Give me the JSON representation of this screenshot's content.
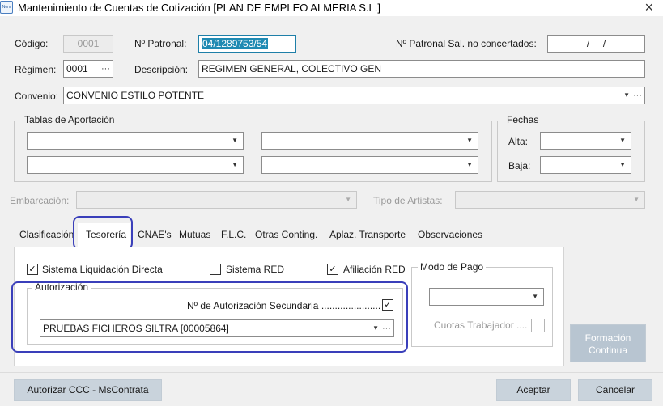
{
  "window": {
    "title": "Mantenimiento de Cuentas de Cotización [PLAN DE EMPLEO ALMERIA S.L.]",
    "app_icon_text": "Nom"
  },
  "header": {
    "codigo_label": "Código:",
    "codigo_value": "0001",
    "patronal_label": "Nº Patronal:",
    "patronal_value": "04/1289753/54",
    "patronal_sal_label": "Nº Patronal Sal. no concertados:",
    "patronal_sal_value": "/     /",
    "regimen_label": "Régimen:",
    "regimen_value": "0001",
    "descripcion_label": "Descripción:",
    "descripcion_value": "REGIMEN GENERAL, COLECTIVO GEN",
    "convenio_label": "Convenio:",
    "convenio_value": "CONVENIO ESTILO POTENTE"
  },
  "tablas": {
    "title": "Tablas de Aportación"
  },
  "fechas": {
    "title": "Fechas",
    "alta_label": "Alta:",
    "baja_label": "Baja:"
  },
  "embarcacion": {
    "label": "Embarcación:",
    "tipo_artistas_label": "Tipo de Artistas:"
  },
  "tabs": [
    "Clasificación",
    "Tesorería",
    "CNAE's",
    "Mutuas",
    "F.L.C.",
    "Otras Conting.",
    "Aplaz. Transporte",
    "Observaciones"
  ],
  "tesoreria": {
    "sistema_liquidacion_label": "Sistema Liquidación Directa",
    "sistema_red_label": "Sistema RED",
    "afiliacion_red_label": "Afiliación RED",
    "autorizacion_title": "Autorización",
    "autorizacion_secundaria_label": "Nº de Autorización Secundaria ......................",
    "autorizacion_value": "PRUEBAS FICHEROS SILTRA [00005864]",
    "modo_pago_title": "Modo de Pago",
    "cuotas_trabajador_label": "Cuotas Trabajador ....",
    "formacion_button": "Formación Continua"
  },
  "footer": {
    "autorizar_button": "Autorizar CCC - MsContrata",
    "aceptar_button": "Aceptar",
    "cancelar_button": "Cancelar"
  }
}
